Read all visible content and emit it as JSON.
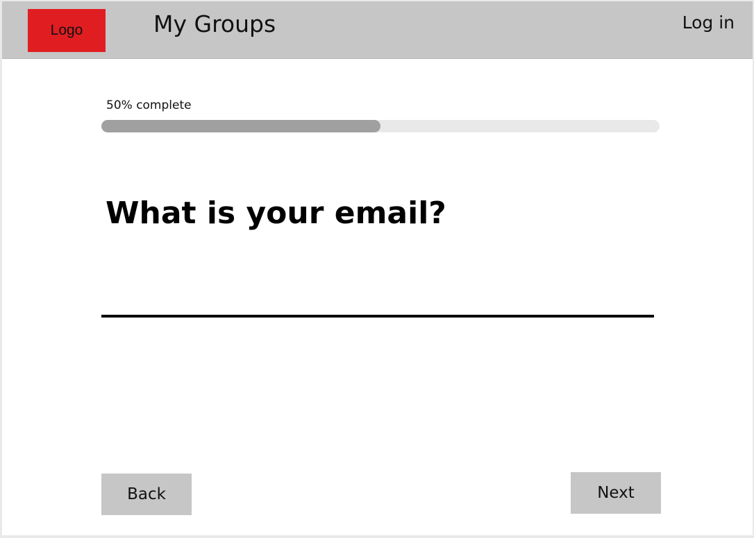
{
  "header": {
    "logo_label": "Logo",
    "title": "My Groups",
    "login_label": "Log in"
  },
  "progress": {
    "label": "50% complete",
    "fraction": 0.5
  },
  "form": {
    "question": "What is your email?",
    "email_value": "",
    "email_placeholder": ""
  },
  "navigation": {
    "back_label": "Back",
    "next_label": "Next"
  },
  "colors": {
    "logo_bg": "#e01e22",
    "header_bg": "#c6c6c6",
    "progress_fill": "#a0a0a0",
    "progress_track": "#e9e9e9",
    "button_bg": "#c6c6c6"
  }
}
